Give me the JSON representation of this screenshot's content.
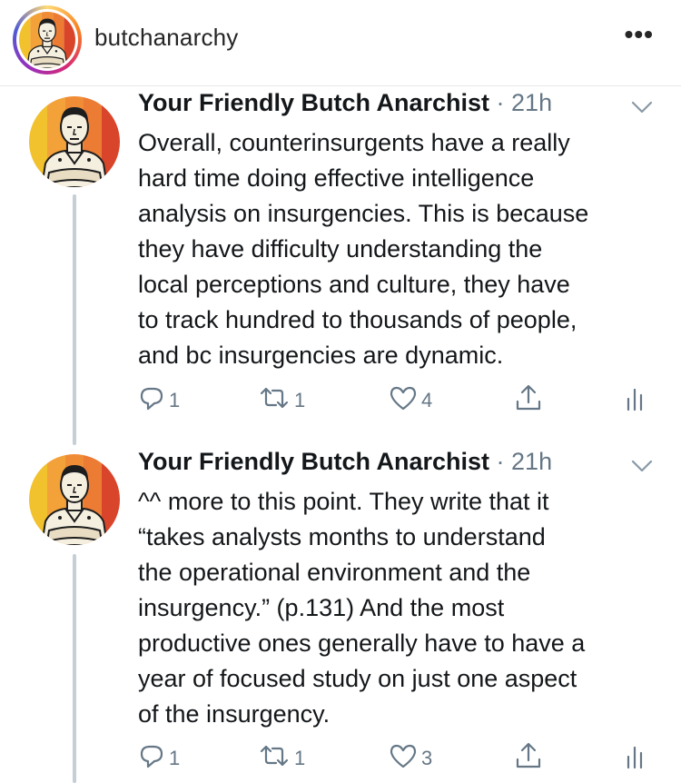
{
  "header": {
    "username": "butchanarchy",
    "more_label": "•••"
  },
  "tweets": [
    {
      "name": "Your Friendly Butch Anarchist",
      "meta": " · 21h",
      "text": "Overall, counterinsurgents have a really\nhard time doing effective intelligence\nanalysis on insurgencies. This is because\nthey have difficulty understanding the\nlocal perceptions and culture, they have\nto track hundred to thousands of people,\nand bc insurgencies are dynamic.",
      "replies": "1",
      "retweets": "1",
      "likes": "4"
    },
    {
      "name": "Your Friendly Butch Anarchist",
      "meta": " · 21h",
      "text": "^^ more to this point. They write that it\n“takes analysts months to understand\nthe operational environment and the\ninsurgency.” (p.131) And the most\nproductive ones generally have to have a\nyear of focused study on just one aspect\nof the insurgency.",
      "replies": "1",
      "retweets": "1",
      "likes": "3"
    }
  ],
  "icons": {
    "reply": "reply-icon",
    "retweet": "retweet-icon",
    "like": "heart-icon",
    "share": "share-icon",
    "analytics": "analytics-icon",
    "caret": "chevron-down-icon"
  },
  "colors": {
    "text": "#14171a",
    "muted": "#657786",
    "thread_line": "#c4cfd6"
  }
}
